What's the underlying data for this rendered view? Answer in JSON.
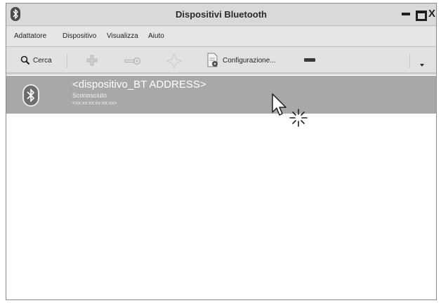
{
  "window": {
    "title": "Dispositivi Bluetooth",
    "app_icon": "bluetooth-icon",
    "controls": {
      "minimize": "minimize-icon",
      "maximize": "maximize-icon",
      "close_label": "X"
    }
  },
  "menubar": {
    "items": [
      "Adattatore",
      "Dispositivo",
      "Visualizza",
      "Aiuto"
    ]
  },
  "toolbar": {
    "search_label": "Cerca",
    "search_icon": "search-icon",
    "add_icon": "plus-icon",
    "pair_icon": "key-icon",
    "favorite_icon": "star-icon",
    "config_icon": "document-gear-icon",
    "config_label": "Configurazione...",
    "remove_icon": "minus-icon",
    "menu_icon": "chevron-down-icon"
  },
  "devices": [
    {
      "name": "<dispositivo_BT ADDRESS>",
      "type": "Sconosciuto",
      "address": "<xx:xx:xx:xx:xx:xx>",
      "icon": "bluetooth-icon",
      "selected": true
    }
  ],
  "colors": {
    "selection": "#a8a8a8",
    "window_bg": "#e2e2e2",
    "list_bg": "#ffffff"
  }
}
